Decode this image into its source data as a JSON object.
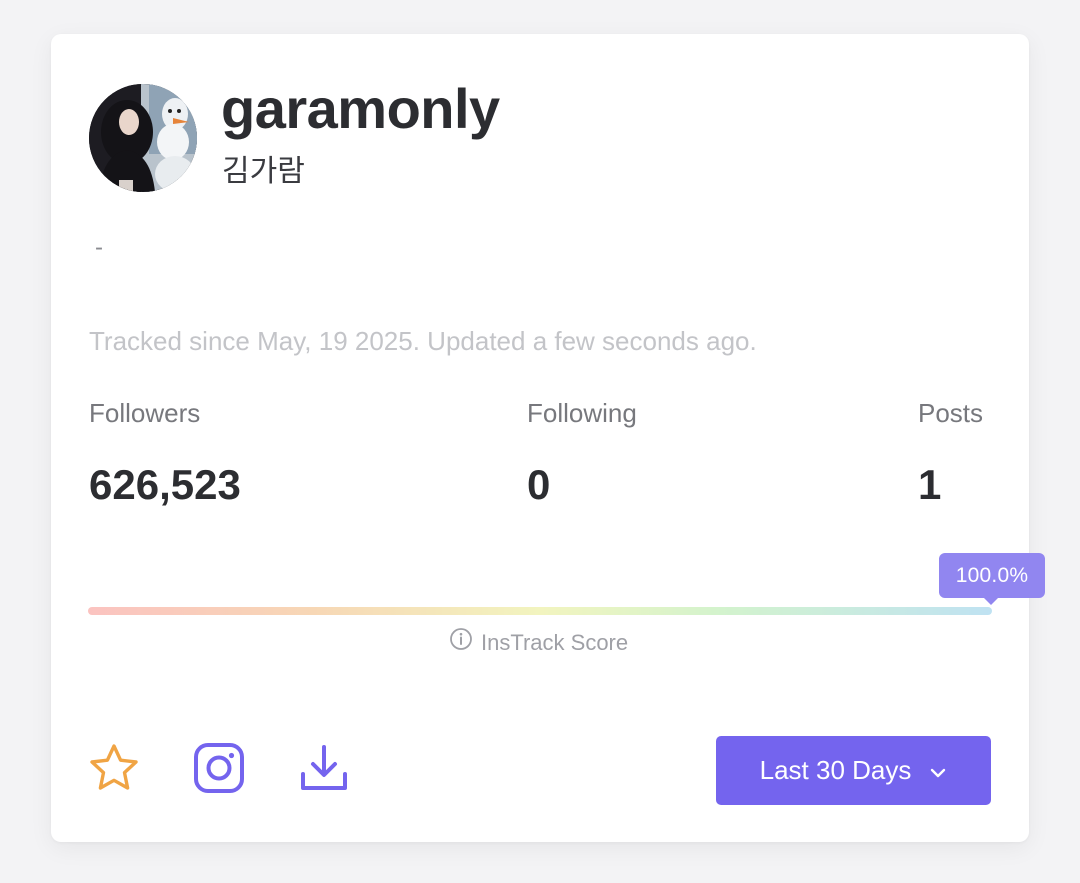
{
  "profile": {
    "username": "garamonly",
    "full_name": "김가람",
    "bio": "-",
    "tracked_text": "Tracked since May, 19 2025. Updated a few seconds ago."
  },
  "stats": {
    "followers": {
      "label": "Followers",
      "value": "626,523"
    },
    "following": {
      "label": "Following",
      "value": "0"
    },
    "posts": {
      "label": "Posts",
      "value": "1"
    }
  },
  "score": {
    "badge": "100.0%",
    "fraction": 1.0,
    "caption": "InsTrack Score"
  },
  "actions": {
    "range_label": "Last 30 Days",
    "icons": [
      "star-icon",
      "instagram-icon",
      "download-icon",
      "chevron-down-icon",
      "info-icon"
    ]
  },
  "colors": {
    "accent": "#7464ee",
    "badge": "#9186f0",
    "star": "#f0a444",
    "icon": "#7464ee"
  }
}
